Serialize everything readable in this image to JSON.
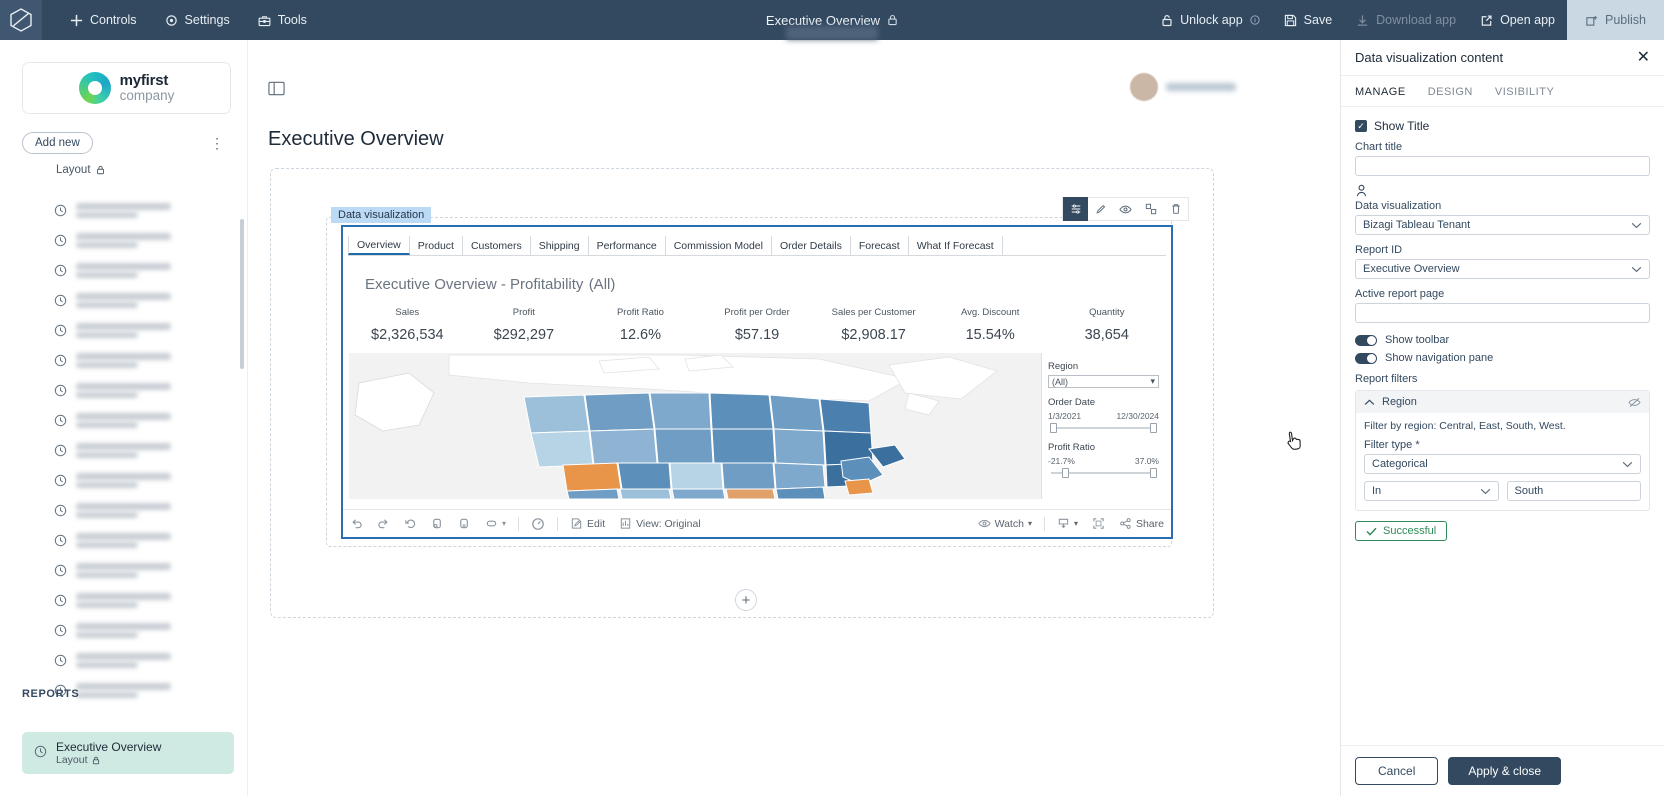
{
  "topbar": {
    "logo_icon": "hexagon-logo-icon",
    "left_items": [
      {
        "label": "Controls",
        "icon": "plus-icon"
      },
      {
        "label": "Settings",
        "icon": "gear-icon"
      },
      {
        "label": "Tools",
        "icon": "toolbox-icon"
      }
    ],
    "title": "Executive Overview",
    "title_lock_icon": "lock-icon",
    "right_items": [
      {
        "label": "Unlock app",
        "icon": "lock-icon",
        "suffix_icon": "info-icon",
        "disabled": false
      },
      {
        "label": "Save",
        "icon": "save-icon",
        "disabled": false
      },
      {
        "label": "Download app",
        "icon": "download-icon",
        "disabled": true
      },
      {
        "label": "Open app",
        "icon": "external-link-icon",
        "disabled": false
      }
    ],
    "publish_label": "Publish",
    "publish_icon": "publish-icon"
  },
  "sidebar": {
    "logo_name": "myfirst",
    "logo_sub": "company",
    "add_new_label": "Add new",
    "kebab_icon": "more-vertical-icon",
    "layout_label": "Layout",
    "layout_lock_icon": "lock-icon",
    "items": [
      {
        "icon": "clock-icon"
      },
      {
        "icon": "layers-icon"
      },
      {
        "icon": "clock-icon"
      },
      {
        "icon": "hierarchy-icon"
      },
      {
        "icon": "clock-icon"
      },
      {
        "icon": "clock-icon"
      },
      {
        "icon": "checkbox-icon"
      },
      {
        "icon": "clock-icon"
      },
      {
        "icon": "table-icon"
      },
      {
        "icon": "clock-icon"
      },
      {
        "icon": "clock-icon"
      },
      {
        "icon": "clock-icon"
      },
      {
        "icon": "clock-icon"
      },
      {
        "icon": "clock-icon"
      },
      {
        "icon": "clock-icon"
      },
      {
        "icon": "clock-icon"
      },
      {
        "icon": "clock-icon"
      }
    ],
    "reports_header": "REPORTS",
    "selected": {
      "title": "Executive Overview",
      "subtitle": "Layout",
      "lock_icon": "lock-icon",
      "icon": "clock-icon"
    }
  },
  "main": {
    "panel_toggle_icon": "panel-toggle-icon",
    "page_title": "Executive Overview",
    "widget_tag": "Data visualization",
    "widget_actions": [
      {
        "icon": "properties-icon",
        "active": true
      },
      {
        "icon": "pencil-icon",
        "active": false
      },
      {
        "icon": "eye-icon",
        "active": false
      },
      {
        "icon": "move-icon",
        "active": false
      },
      {
        "icon": "trash-icon",
        "active": false
      }
    ],
    "add_widget_icon": "plus-icon"
  },
  "tableau": {
    "tabs": [
      {
        "label": "Overview",
        "selected": true
      },
      {
        "label": "Product",
        "selected": false
      },
      {
        "label": "Customers",
        "selected": false
      },
      {
        "label": "Shipping",
        "selected": false
      },
      {
        "label": "Performance",
        "selected": false
      },
      {
        "label": "Commission Model",
        "selected": false
      },
      {
        "label": "Order Details",
        "selected": false
      },
      {
        "label": "Forecast",
        "selected": false
      },
      {
        "label": "What If Forecast",
        "selected": false
      }
    ],
    "viz_title": "Executive Overview - Profitability",
    "viz_title_suffix": "(All)",
    "kpis": [
      {
        "label": "Sales",
        "value": "$2,326,534"
      },
      {
        "label": "Profit",
        "value": "$292,297"
      },
      {
        "label": "Profit Ratio",
        "value": "12.6%"
      },
      {
        "label": "Profit per Order",
        "value": "$57.19"
      },
      {
        "label": "Sales per Customer",
        "value": "$2,908.17"
      },
      {
        "label": "Avg. Discount",
        "value": "15.54%"
      },
      {
        "label": "Quantity",
        "value": "38,654"
      }
    ],
    "filters": {
      "region_label": "Region",
      "region_value": "(All)",
      "order_date_label": "Order Date",
      "order_date_min": "1/3/2021",
      "order_date_max": "12/30/2024",
      "profit_ratio_label": "Profit Ratio",
      "profit_ratio_min": "-21.7%",
      "profit_ratio_max": "37.0%"
    },
    "toolbar": {
      "left_icons": [
        {
          "icon": "undo-icon"
        },
        {
          "icon": "redo-icon"
        },
        {
          "icon": "revert-icon"
        },
        {
          "icon": "refresh-data-icon"
        },
        {
          "icon": "pause-updates-icon"
        },
        {
          "icon": "alert-icon"
        },
        {
          "icon": "chevron-down-icon"
        }
      ],
      "info_icon": "dashboard-info-icon",
      "edit_label": "Edit",
      "edit_icon": "edit-icon",
      "view_label": "View: Original",
      "view_icon": "view-icon",
      "watch_label": "Watch",
      "watch_icon": "eye-icon",
      "watch_caret": "chevron-down-icon",
      "share_label": "Share",
      "share_icon": "share-icon",
      "download_icon": "download-box-icon",
      "fullscreen_icon": "fullscreen-icon"
    }
  },
  "chart_data": {
    "type": "map",
    "title": "Executive Overview - Profitability (All)",
    "description": "Filled choropleth map of United States / North America shaded by profit. Blue shades indicate profitable states, orange shades indicate unprofitable states.",
    "color_scale": {
      "negative": "#e8954a",
      "negative_light": "#f6c79a",
      "neutral": "#f2f2f2",
      "positive_light": "#bcd8ea",
      "positive": "#6f9dc4",
      "positive_dark": "#3b6f9e"
    },
    "kpis": [
      {
        "label": "Sales",
        "value": 2326534,
        "display": "$2,326,534"
      },
      {
        "label": "Profit",
        "value": 292297,
        "display": "$292,297"
      },
      {
        "label": "Profit Ratio",
        "value": 12.6,
        "display": "12.6%"
      },
      {
        "label": "Profit per Order",
        "value": 57.19,
        "display": "$57.19"
      },
      {
        "label": "Sales per Customer",
        "value": 2908.17,
        "display": "$2,908.17"
      },
      {
        "label": "Avg. Discount",
        "value": 15.54,
        "display": "15.54%"
      },
      {
        "label": "Quantity",
        "value": 38654,
        "display": "38,654"
      }
    ],
    "filters": [
      {
        "name": "Region",
        "type": "dropdown",
        "value": "(All)"
      },
      {
        "name": "Order Date",
        "type": "range",
        "min": "1/3/2021",
        "max": "12/30/2024"
      },
      {
        "name": "Profit Ratio",
        "type": "range",
        "min": "-21.7%",
        "max": "37.0%"
      }
    ]
  },
  "rightpanel": {
    "title": "Data visualization content",
    "close_icon": "close-icon",
    "tabs": [
      {
        "label": "MANAGE",
        "selected": true
      },
      {
        "label": "DESIGN",
        "selected": false
      },
      {
        "label": "VISIBILITY",
        "selected": false
      }
    ],
    "show_title_label": "Show Title",
    "show_title_checked": true,
    "chart_title_label": "Chart title",
    "chart_title_value": "",
    "person_icon": "person-icon",
    "data_viz_label": "Data visualization",
    "data_viz_value": "Bizagi Tableau Tenant",
    "report_id_label": "Report ID",
    "report_id_value": "Executive Overview",
    "active_page_label": "Active report page",
    "active_page_value": "",
    "toggles": [
      {
        "label": "Show toolbar",
        "on": true
      },
      {
        "label": "Show navigation pane",
        "on": true
      }
    ],
    "report_filters_label": "Report filters",
    "filter_card": {
      "name": "Region",
      "collapse_icon": "chevron-up-icon",
      "hide_icon": "eye-off-icon",
      "description": "Filter by region: Central, East, South, West.",
      "filter_type_label": "Filter type *",
      "filter_type_value": "Categorical",
      "operator_value": "In",
      "operand_value": "South"
    },
    "status_badge": "Successful",
    "status_icon": "check-icon",
    "cancel_label": "Cancel",
    "apply_label": "Apply & close"
  },
  "colors": {
    "navy": "#33495f",
    "teal": "#63cfbf",
    "accent_blue": "#2a6db0",
    "success_green": "#2e8b57"
  }
}
